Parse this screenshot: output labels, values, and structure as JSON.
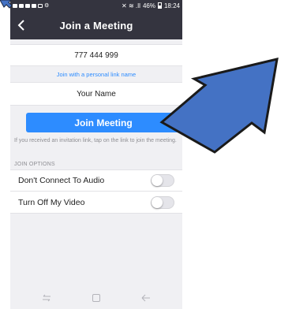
{
  "status_bar": {
    "status_text": "46%",
    "time": "18:24",
    "signal_text": "✕ ≋ .ǀl"
  },
  "header": {
    "title": "Join a Meeting",
    "back_icon": "chevron-left-icon"
  },
  "form": {
    "meeting_id": "777 444 999",
    "personal_link_label": "Join with a personal link name",
    "name_value": "Your Name"
  },
  "join_button": {
    "label": "Join Meeting",
    "color": "#2d8cff"
  },
  "hint_text": "If you received an invitation link, tap on the link to join the meeting.",
  "join_options": {
    "header": "JOIN OPTIONS",
    "items": [
      {
        "label": "Don't Connect To Audio",
        "enabled": false
      },
      {
        "label": "Turn Off My Video",
        "enabled": false
      }
    ]
  },
  "nav_bar": {
    "icons": [
      "recents-back-icon",
      "home-square-icon",
      "back-arrow-icon"
    ]
  },
  "annotations": {
    "arrow_color": "#4472c4",
    "arrow_outline": "#1f2a44"
  },
  "colors": {
    "header_bg": "#34343f",
    "accent": "#2d8cff",
    "screen_bg": "#f0f0f3"
  }
}
